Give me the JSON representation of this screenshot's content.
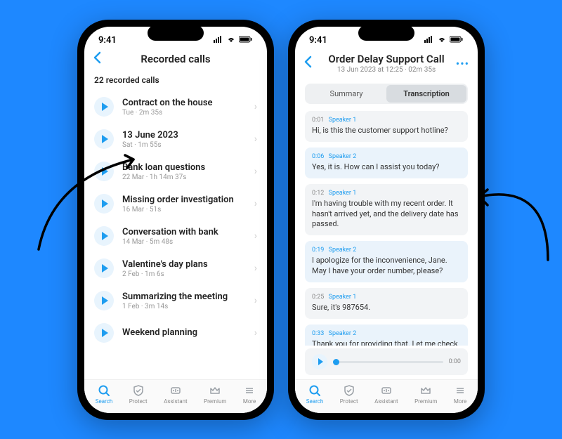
{
  "status": {
    "time": "9:41"
  },
  "left": {
    "title": "Recorded calls",
    "count_label": "22 recorded calls",
    "items": [
      {
        "title": "Contract on the house",
        "sub": "Tue · 2m 35s"
      },
      {
        "title": "13 June 2023",
        "sub": "Sat · 1m 55s"
      },
      {
        "title": "Bank loan questions",
        "sub": "22 Mar · 1h 14m 37s"
      },
      {
        "title": "Missing order investigation",
        "sub": "16 Mar · 51s"
      },
      {
        "title": "Conversation with bank",
        "sub": "14 Mar · 5m 48s"
      },
      {
        "title": "Valentine's day plans",
        "sub": "2 Feb · 1m 6s"
      },
      {
        "title": "Summarizing the meeting",
        "sub": "1 Feb · 3m 14s"
      },
      {
        "title": "Weekend planning",
        "sub": ""
      }
    ]
  },
  "right": {
    "title": "Order Delay Support Call",
    "subtitle": "13 Jun 2023 at 12:25 · 02m 35s",
    "tabs": {
      "summary": "Summary",
      "transcription": "Transcription"
    },
    "transcript": [
      {
        "time": "0:01",
        "speaker": "Speaker 1",
        "who": 1,
        "text": "Hi, is this the customer support hotline?"
      },
      {
        "time": "0:06",
        "speaker": "Speaker 2",
        "who": 2,
        "text": "Yes, it is. How can I assist you today?"
      },
      {
        "time": "0:12",
        "speaker": "Speaker 1",
        "who": 1,
        "text": "I'm having trouble with my recent order. It hasn't arrived yet, and the delivery date has passed."
      },
      {
        "time": "0:19",
        "speaker": "Speaker 2",
        "who": 2,
        "text": "I apologize for the inconvenience, Jane. May I have your order number, please?"
      },
      {
        "time": "0:25",
        "speaker": "Speaker 1",
        "who": 1,
        "text": "Sure, it's 987654."
      },
      {
        "time": "0:33",
        "speaker": "Speaker 2",
        "who": 2,
        "text": "Thank you for providing that. Let me check the"
      }
    ],
    "player_time": "0:00"
  },
  "tabs": [
    {
      "label": "Search",
      "icon": "search"
    },
    {
      "label": "Protect",
      "icon": "shield"
    },
    {
      "label": "Assistant",
      "icon": "assistant"
    },
    {
      "label": "Premium",
      "icon": "crown"
    },
    {
      "label": "More",
      "icon": "more"
    }
  ]
}
